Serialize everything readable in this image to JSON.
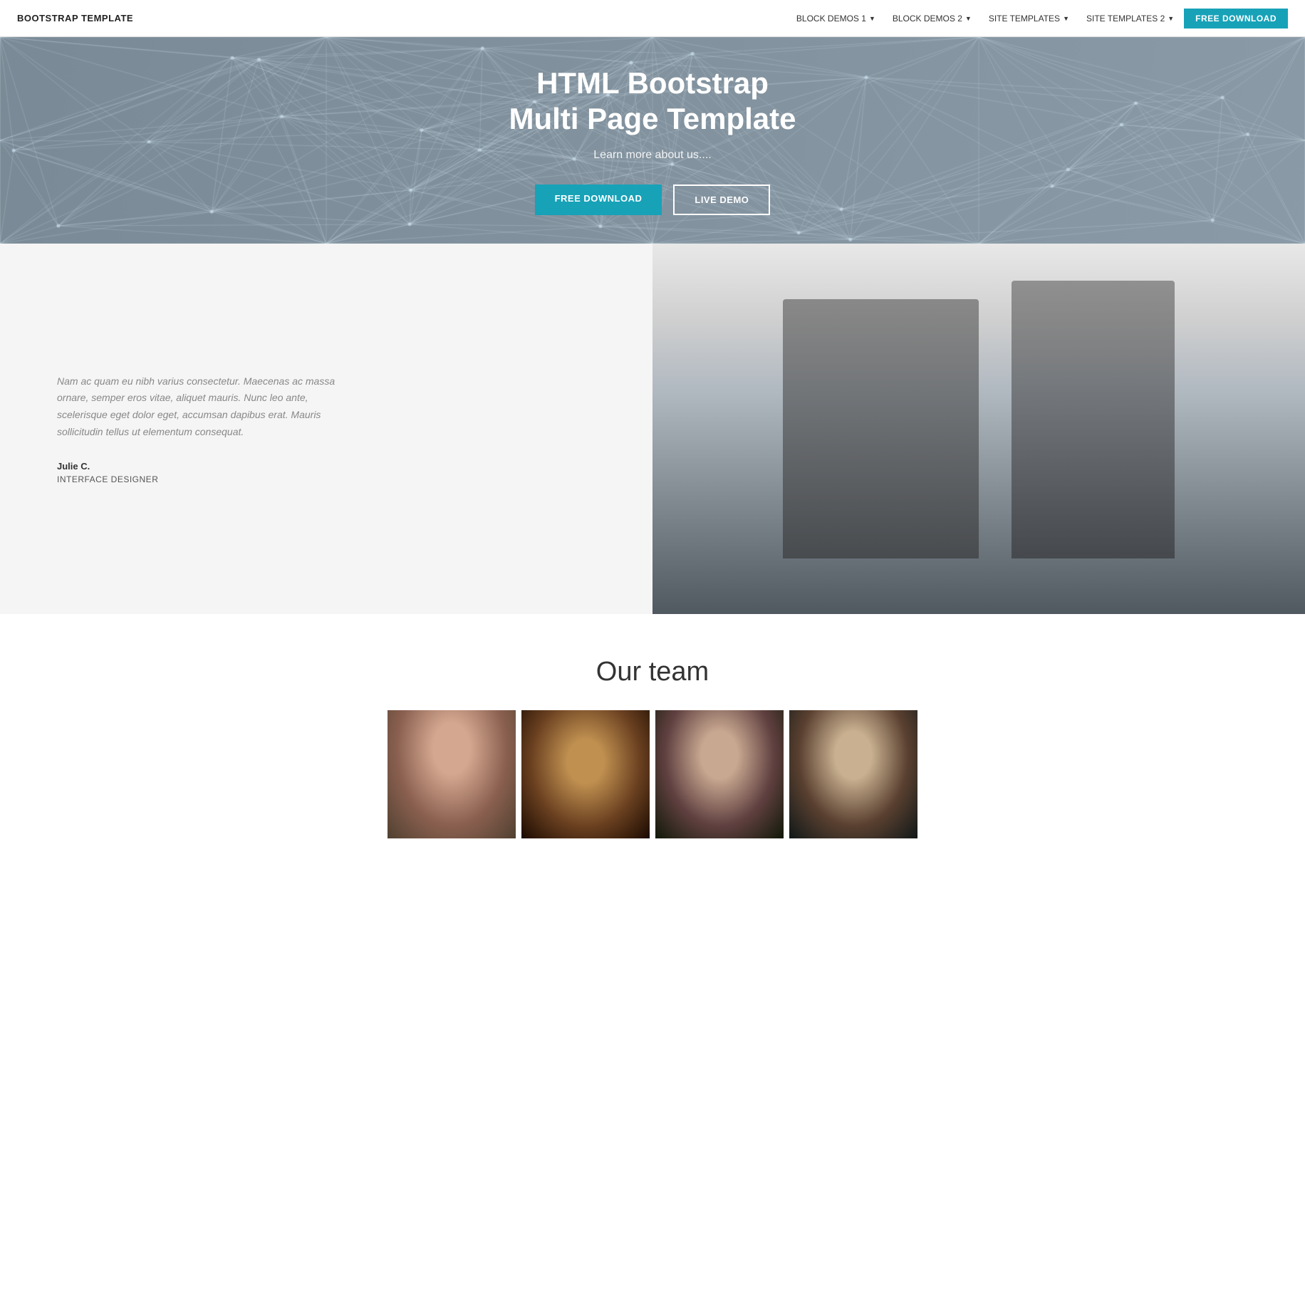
{
  "nav": {
    "brand": "BOOTSTRAP TEMPLATE",
    "links": [
      {
        "label": "BLOCK DEMOS 1",
        "has_dropdown": true
      },
      {
        "label": "BLOCK DEMOS 2",
        "has_dropdown": true
      },
      {
        "label": "SITE TEMPLATES",
        "has_dropdown": true
      },
      {
        "label": "SITE TEMPLATES 2",
        "has_dropdown": true
      }
    ],
    "cta": "FREE DOWNLOAD"
  },
  "hero": {
    "title_line1": "HTML Bootstrap",
    "title_line2": "Multi Page Template",
    "subtitle": "Learn more about us....",
    "btn_download": "FREE DOWNLOAD",
    "btn_demo": "LIVE DEMO"
  },
  "feature": {
    "quote": "Nam ac quam eu nibh varius consectetur. Maecenas ac massa ornare, semper eros vitae, aliquet mauris. Nunc leo ante, scelerisque eget dolor eget, accumsan dapibus erat. Mauris sollicitudin tellus ut elementum consequat.",
    "name": "Julie C.",
    "role": "INTERFACE DESIGNER"
  },
  "team": {
    "title": "Our team",
    "members": [
      {
        "id": 1,
        "alt": "Team member 1 - woman with hair up"
      },
      {
        "id": 2,
        "alt": "Team member 2 - woman with long hair"
      },
      {
        "id": 3,
        "alt": "Team member 3 - woman with curly hair"
      },
      {
        "id": 4,
        "alt": "Team member 4 - woman with short hair"
      }
    ]
  }
}
